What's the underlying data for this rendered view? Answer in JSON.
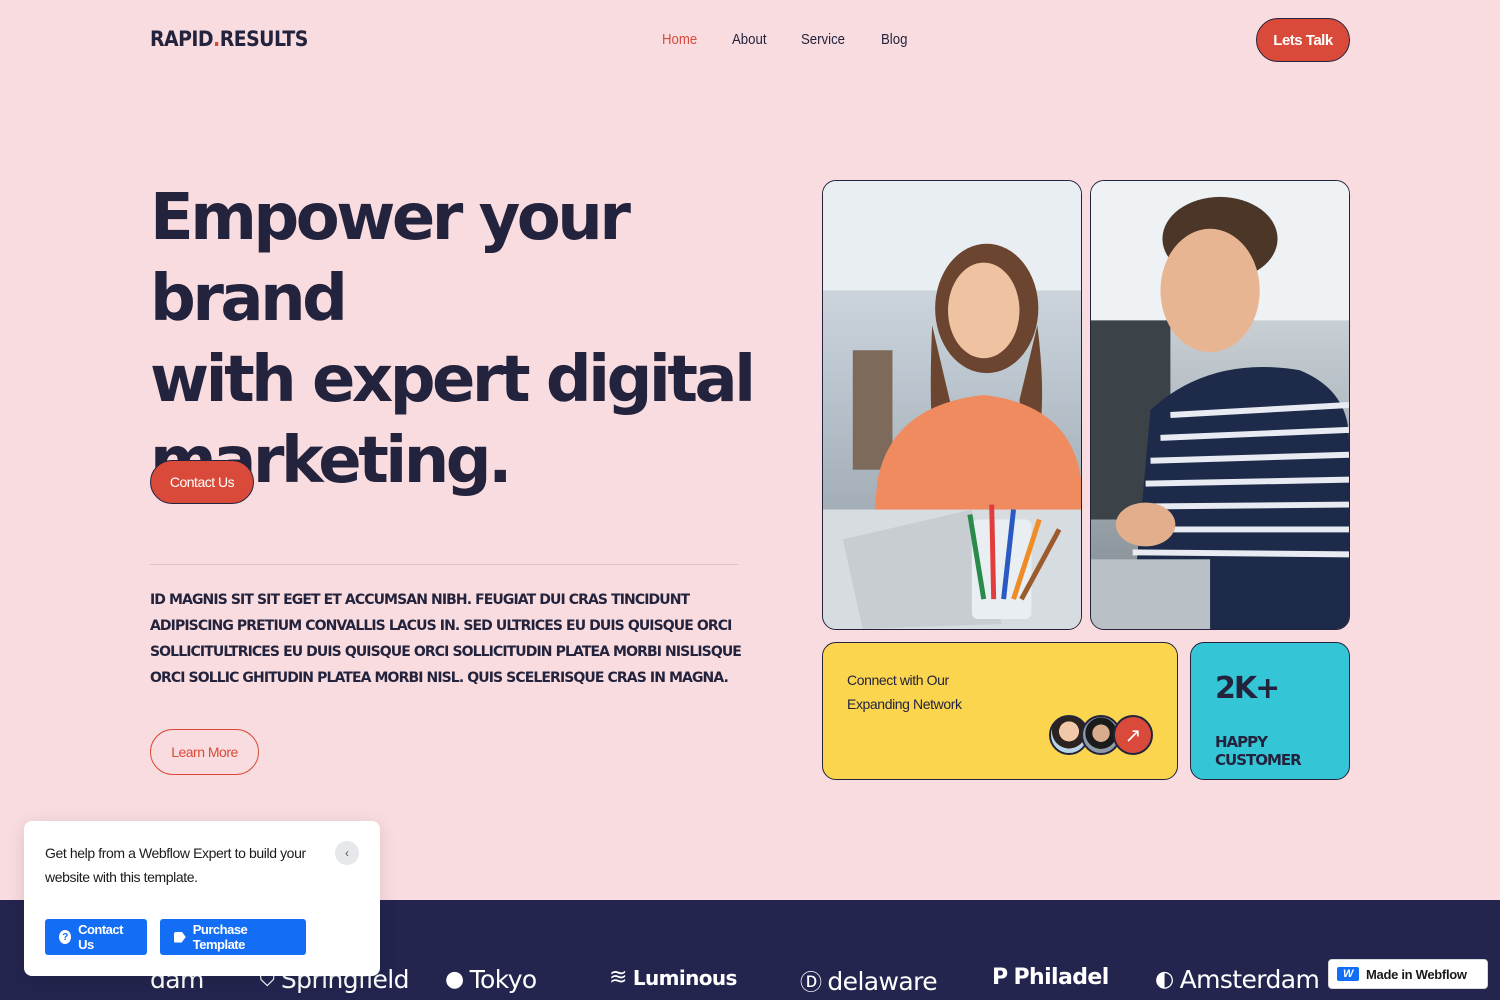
{
  "logo": {
    "part1": "RAPID",
    "dot": ".",
    "part2": "RESULTS"
  },
  "nav": {
    "items": [
      {
        "label": "Home",
        "active": true
      },
      {
        "label": "About"
      },
      {
        "label": "Service"
      },
      {
        "label": "Blog"
      }
    ],
    "cta_label": "Lets Talk"
  },
  "hero": {
    "title_line1": "Empower your brand",
    "title_line2": "with expert digital",
    "title_line3": "marketing.",
    "contact_label": "Contact Us",
    "description": "Id magnis sit sit eget et accumsan nibh. Feugiat dui cras tincidunt adipiscing pretium convallis lacus in. Sed ultrices eu duis quisque orci sollicitultrices eu duis quisque orci sollicitudin platea morbi nislisque orci sollic ghitudin platea morbi nisl. Quis scelerisque cras in magna.",
    "learn_more_label": "Learn More"
  },
  "cards": {
    "network": {
      "line1": "Connect with Our",
      "line2": "Expanding Network",
      "arrow_icon": "arrow-up-right-icon"
    },
    "customers": {
      "count": "2K+",
      "label": "HAPPY CUSTOMER"
    }
  },
  "brands": [
    {
      "name": "dam",
      "icon": ""
    },
    {
      "name": "Springfield",
      "icon": "shield-icon"
    },
    {
      "name": "Tokyo",
      "icon": "circle-icon"
    },
    {
      "name": "Luminous",
      "icon": "stripes-icon"
    },
    {
      "name": "delaware",
      "icon": "d-icon"
    },
    {
      "name": "Philadel",
      "icon": "p-icon"
    },
    {
      "name": "Amsterdam",
      "icon": "toggle-icon"
    }
  ],
  "popup": {
    "message": "Get help from a Webflow Expert to build your website with this template.",
    "contact_label": "Contact Us",
    "purchase_label": "Purchase Template"
  },
  "badge": {
    "label": "Made in Webflow"
  },
  "colors": {
    "background": "#f9dcdf",
    "accent": "#d94a3a",
    "dark": "#23233d",
    "yellow_card": "#fbd54d",
    "cyan_card": "#34c6d6",
    "strip": "#23254f",
    "webflow_blue": "#146ef5"
  }
}
